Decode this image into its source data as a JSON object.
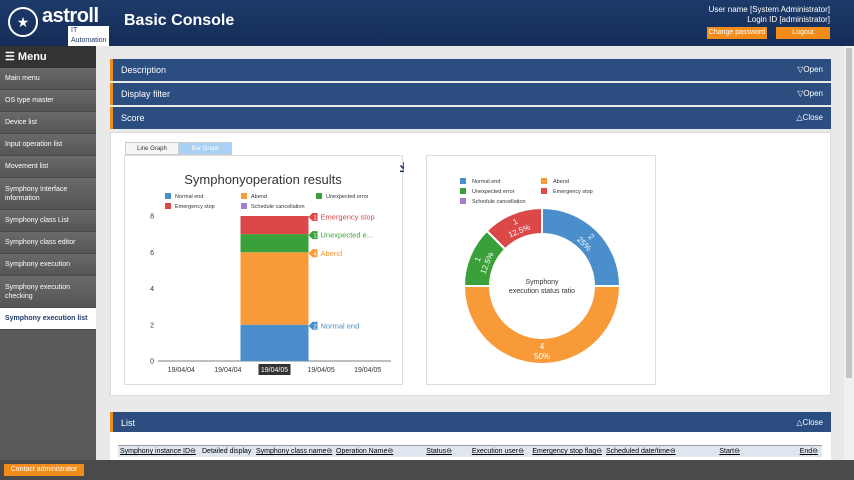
{
  "header": {
    "logo_name": "astroll",
    "logo_sub": "IT Automation",
    "title": "Basic Console",
    "user_name": "User name [System Administrator]",
    "login_id": "Login ID [administrator]",
    "change_password": "Change password",
    "logout": "Logout"
  },
  "sidebar": {
    "menu_label": "☰ Menu",
    "items": [
      {
        "label": "Main menu"
      },
      {
        "label": "OS type master"
      },
      {
        "label": "Device list"
      },
      {
        "label": "Input operation list"
      },
      {
        "label": "Movement list"
      },
      {
        "label": "Symphony Interface information"
      },
      {
        "label": "Symphony class List"
      },
      {
        "label": "Symphony class editor"
      },
      {
        "label": "Symphony execution"
      },
      {
        "label": "Symphony execution checking"
      },
      {
        "label": "Symphony execution list"
      }
    ]
  },
  "sections": {
    "description": {
      "label": "Description",
      "toggle": "▽Open"
    },
    "display_filter": {
      "label": "Display filter",
      "toggle": "▽Open"
    },
    "score": {
      "label": "Score",
      "toggle": "△Close"
    },
    "list": {
      "label": "List",
      "toggle": "△Close"
    }
  },
  "tabs": {
    "line": "Line Graph",
    "bar": "Bar Graph"
  },
  "chart_data": [
    {
      "type": "bar",
      "title": "Symphonyoperation results",
      "categories": [
        "19/04/04",
        "19/04/04",
        "19/04/05",
        "19/04/05",
        "19/04/05"
      ],
      "highlighted_category": "19/04/05",
      "ylim": [
        0,
        8
      ],
      "yticks": [
        0,
        2,
        4,
        6,
        8
      ],
      "legend": [
        {
          "name": "Normal end",
          "color": "#4a8fcb"
        },
        {
          "name": "Abend",
          "color": "#f99a38"
        },
        {
          "name": "Unexpected error",
          "color": "#3aa13a"
        },
        {
          "name": "Emergency stop",
          "color": "#dc4848"
        },
        {
          "name": "Schedule cancellation",
          "color": "#a57ccf"
        }
      ],
      "series": [
        {
          "name": "Normal end",
          "values": [
            0,
            0,
            2,
            0,
            0
          ],
          "color": "#4a8fcb"
        },
        {
          "name": "Abend",
          "values": [
            0,
            0,
            4,
            0,
            0
          ],
          "color": "#f99a38"
        },
        {
          "name": "Unexpected error",
          "values": [
            0,
            0,
            1,
            0,
            0
          ],
          "color": "#3aa13a"
        },
        {
          "name": "Emergency stop",
          "values": [
            0,
            0,
            1,
            0,
            0
          ],
          "color": "#dc4848"
        }
      ],
      "annotations": [
        {
          "count": "1",
          "text": "Emergency stop",
          "color": "#dc4848"
        },
        {
          "count": "1",
          "text": "Unexpected e...",
          "color": "#3aa13a"
        },
        {
          "count": "4",
          "text": "Abend",
          "color": "#f99a38"
        },
        {
          "count": "2",
          "text": "Normal end",
          "color": "#4a8fcb"
        }
      ]
    },
    {
      "type": "pie",
      "center_label_1": "Symphony",
      "center_label_2": "execution status ratio",
      "legend": [
        {
          "name": "Normal end",
          "color": "#4a8fcb"
        },
        {
          "name": "Abend",
          "color": "#f99a38"
        },
        {
          "name": "Unexpected error",
          "color": "#3aa13a"
        },
        {
          "name": "Emergency stop",
          "color": "#dc4848"
        },
        {
          "name": "Schedule cancellation",
          "color": "#a57ccf"
        }
      ],
      "slices": [
        {
          "name": "Normal end",
          "value": 2,
          "percent": "25%",
          "color": "#4a8fcb"
        },
        {
          "name": "Abend",
          "value": 4,
          "percent": "50%",
          "color": "#f99a38"
        },
        {
          "name": "Unexpected error",
          "value": 1,
          "percent": "12.5%",
          "color": "#3aa13a"
        },
        {
          "name": "Emergency stop",
          "value": 1,
          "percent": "12.5%",
          "color": "#dc4848"
        }
      ]
    }
  ],
  "table": {
    "columns": [
      "Symphony instance ID⊖",
      "Detailed display",
      "Symphony class name⊖",
      "Operation Name⊖",
      "Status⊖",
      "Execution user⊖",
      "Emergency stop flag⊖",
      "Scheduled date/time⊖",
      "Start⊖",
      "End⊖"
    ]
  },
  "footer": {
    "contact": "Contact administrator"
  }
}
